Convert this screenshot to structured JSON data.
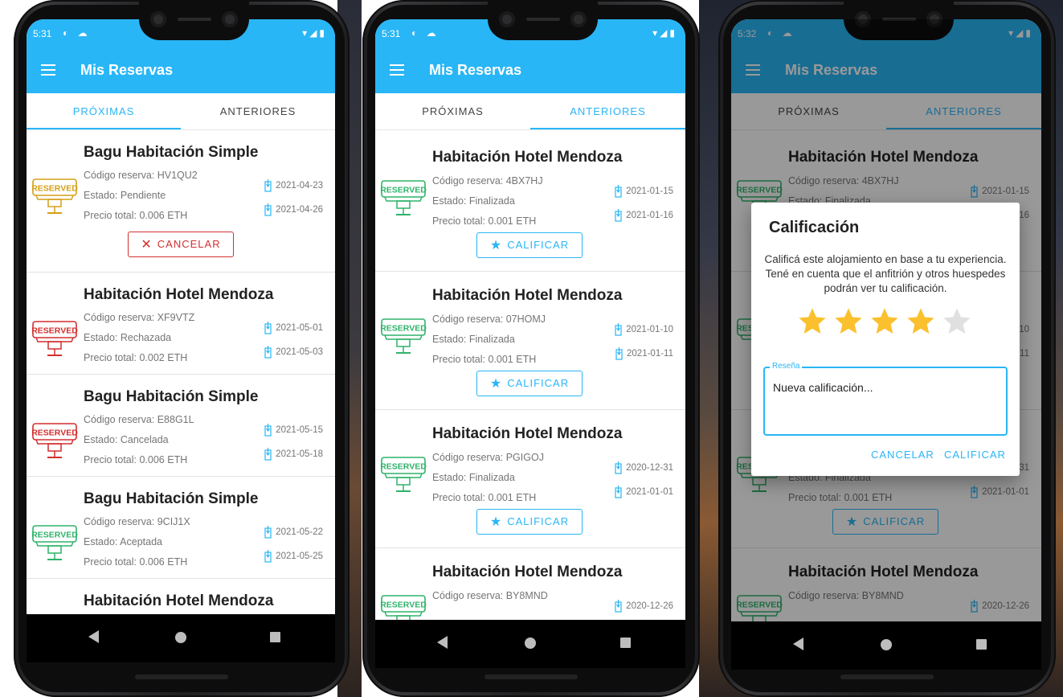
{
  "phones": [
    {
      "status": {
        "time": "5:31"
      },
      "appbar": {
        "title": "Mis Reservas"
      },
      "tabs": [
        {
          "label": "PRÓXIMAS"
        },
        {
          "label": "ANTERIORES"
        }
      ],
      "active_tab": 0,
      "cards": [
        {
          "title": "Bagu Habitación Simple",
          "code": "Código reserva: HV1QU2",
          "status": "Estado: Pendiente",
          "price": "Precio total: 0.006 ETH",
          "checkin": "2021-04-23",
          "checkout": "2021-04-26",
          "stamp_color": "#d4a017",
          "button": {
            "type": "cancel",
            "label": "CANCELAR"
          }
        },
        {
          "title": "Habitación Hotel Mendoza",
          "code": "Código reserva: XF9VTZ",
          "status": "Estado: Rechazada",
          "price": "Precio total: 0.002 ETH",
          "checkin": "2021-05-01",
          "checkout": "2021-05-03",
          "stamp_color": "#d32f2f"
        },
        {
          "title": "Bagu Habitación Simple",
          "code": "Código reserva: E88G1L",
          "status": "Estado: Cancelada",
          "price": "Precio total: 0.006 ETH",
          "checkin": "2021-05-15",
          "checkout": "2021-05-18",
          "stamp_color": "#d32f2f"
        },
        {
          "title": "Bagu Habitación Simple",
          "code": "Código reserva: 9CIJ1X",
          "status": "Estado: Aceptada",
          "price": "Precio total: 0.006 ETH",
          "checkin": "2021-05-22",
          "checkout": "2021-05-25",
          "stamp_color": "#2fb36a"
        },
        {
          "title": "Habitación Hotel Mendoza",
          "stamp_color": "#d32f2f"
        }
      ]
    },
    {
      "status": {
        "time": "5:31"
      },
      "appbar": {
        "title": "Mis Reservas"
      },
      "tabs": [
        {
          "label": "PRÓXIMAS"
        },
        {
          "label": "ANTERIORES"
        }
      ],
      "active_tab": 1,
      "cards": [
        {
          "title": "Habitación Hotel Mendoza",
          "code": "Código reserva: 4BX7HJ",
          "status": "Estado: Finalizada",
          "price": "Precio total: 0.001 ETH",
          "checkin": "2021-01-15",
          "checkout": "2021-01-16",
          "stamp_color": "#2fb36a",
          "button": {
            "type": "rate",
            "label": "CALIFICAR"
          }
        },
        {
          "title": "Habitación Hotel Mendoza",
          "code": "Código reserva: 07HOMJ",
          "status": "Estado: Finalizada",
          "price": "Precio total: 0.001 ETH",
          "checkin": "2021-01-10",
          "checkout": "2021-01-11",
          "stamp_color": "#2fb36a",
          "button": {
            "type": "rate",
            "label": "CALIFICAR"
          }
        },
        {
          "title": "Habitación Hotel Mendoza",
          "code": "Código reserva: PGIGOJ",
          "status": "Estado: Finalizada",
          "price": "Precio total: 0.001 ETH",
          "checkin": "2020-12-31",
          "checkout": "2021-01-01",
          "stamp_color": "#2fb36a",
          "button": {
            "type": "rate",
            "label": "CALIFICAR"
          }
        },
        {
          "title": "Habitación Hotel Mendoza",
          "code": "Código reserva: BY8MND",
          "checkin": "2020-12-26",
          "stamp_color": "#2fb36a"
        }
      ]
    },
    {
      "status": {
        "time": "5:32"
      },
      "appbar": {
        "title": "Mis Reservas"
      },
      "tabs": [
        {
          "label": "PRÓXIMAS"
        },
        {
          "label": "ANTERIORES"
        }
      ],
      "active_tab": 1,
      "cards": [
        {
          "title": "Habitación Hotel Mendoza",
          "code": "Código reserva: 4BX7HJ",
          "status": "Estado: Finalizada",
          "price": "Precio total: 0.001 ETH",
          "checkin": "2021-01-15",
          "checkout": "2021-01-16",
          "stamp_color": "#2fb36a",
          "button": {
            "type": "rate",
            "label": "CALIFICAR"
          }
        },
        {
          "title": "Habitación Hotel Mendoza",
          "code": "Código reserva: 07HOMJ",
          "status": "Estado: Finalizada",
          "price": "Precio total: 0.001 ETH",
          "checkin": "2021-01-10",
          "checkout": "2021-01-11",
          "stamp_color": "#2fb36a",
          "button": {
            "type": "rate",
            "label": "CALIFICAR"
          }
        },
        {
          "title": "Habitación Hotel Mendoza",
          "code": "Código reserva: PGIGOJ",
          "status": "Estado: Finalizada",
          "price": "Precio total: 0.001 ETH",
          "checkin": "2020-12-31",
          "checkout": "2021-01-01",
          "stamp_color": "#2fb36a",
          "button": {
            "type": "rate",
            "label": "CALIFICAR"
          }
        },
        {
          "title": "Habitación Hotel Mendoza",
          "code": "Código reserva: BY8MND",
          "checkin": "2020-12-26",
          "stamp_color": "#2fb36a"
        }
      ],
      "dialog": {
        "title": "Calificación",
        "body": "Calificá este alojamiento en base a tu experiencia. Tené en cuenta que el anfitrión y otros huespedes podrán ver tu calificación.",
        "rating": 4,
        "max_rating": 5,
        "field_label": "Reseña",
        "field_value": "Nueva calificación...",
        "cancel_label": "CANCELAR",
        "confirm_label": "CALIFICAR"
      }
    }
  ],
  "stamp_text": "RESERVED",
  "colors": {
    "accent": "#29b6f6",
    "danger": "#d32f2f",
    "star": "#fbc02d",
    "star_empty": "#e0e0e0"
  }
}
